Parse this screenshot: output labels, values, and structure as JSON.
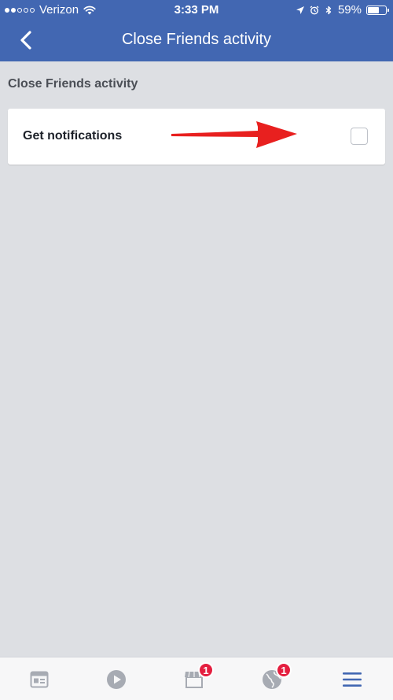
{
  "status_bar": {
    "carrier": "Verizon",
    "time": "3:33 PM",
    "battery": "59%",
    "battery_level": 0.59,
    "signal_bars_filled": 2,
    "signal_bars_total": 5
  },
  "nav": {
    "title": "Close Friends activity",
    "back_icon": "chevron-left-icon"
  },
  "section": {
    "label": "Close Friends activity"
  },
  "setting": {
    "label": "Get notifications",
    "checked": false
  },
  "annotation": {
    "arrow_color": "#e8201f"
  },
  "tabs": [
    {
      "name": "news-feed",
      "icon": "newspaper-icon",
      "badge": ""
    },
    {
      "name": "video",
      "icon": "play-icon",
      "badge": ""
    },
    {
      "name": "marketplace",
      "icon": "shop-icon",
      "badge": "1"
    },
    {
      "name": "notifications",
      "icon": "globe-icon",
      "badge": "1"
    },
    {
      "name": "menu",
      "icon": "hamburger-icon",
      "badge": ""
    }
  ],
  "colors": {
    "brand_blue": "#4267b2",
    "background": "#dddfe3",
    "badge_red": "#e41e3f",
    "menu_active": "#4267b2",
    "tab_inactive": "#a7abb3"
  }
}
